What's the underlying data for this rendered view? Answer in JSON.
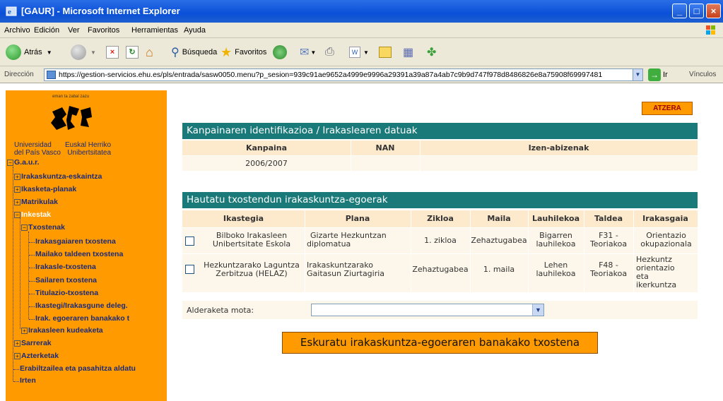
{
  "window": {
    "title": "[GAUR] - Microsoft Internet Explorer"
  },
  "menu": [
    "Archivo",
    "Edición",
    "Ver",
    "Favoritos",
    "Herramientas",
    "Ayuda"
  ],
  "toolbar": {
    "back": "Atrás",
    "search": "Búsqueda",
    "favorites": "Favoritos"
  },
  "address": {
    "label": "Dirección",
    "url": "https://gestion-servicios.ehu.es/pls/entrada/sasw0050.menu?p_sesion=939c91ae9652a4999e9996a29391a39a87a4ab7c9b9d747f978d8486826e8a75908f69997481",
    "go": "Ir",
    "links": "Vínculos"
  },
  "sidebar": {
    "logo_caption": "eman ta zabal zazu",
    "uni_left": [
      "Universidad",
      "del País Vasco"
    ],
    "uni_right": [
      "Euskal Herriko",
      "Unibertsitatea"
    ],
    "tree": {
      "root": "G.a.u.r.",
      "items": [
        "Irakaskuntza-eskaintza",
        "Ikasketa-planak",
        "Matrikulak",
        "Inkestak",
        "Txostenak",
        "Irakasgaiaren txostena",
        "Mailako taldeen txostena",
        "Irakasle-txostena",
        "Sailaren txostena",
        "Titulazio-txostena",
        "Ikastegi/Irakasgune deleg.",
        "Irak. egoeraren banakako t",
        "Irakasleen kudeaketa",
        "Sarrerak",
        "Azterketak",
        "Erabiltzailea eta pasahitza aldatu",
        "Irten"
      ]
    }
  },
  "main": {
    "back_button": "ATZERA",
    "section1": {
      "title": "Kanpainaren identifikazioa / Irakaslearen datuak",
      "headers": [
        "Kanpaina",
        "NAN",
        "Izen-abizenak"
      ],
      "values": [
        "2006/2007",
        "",
        ""
      ]
    },
    "section2": {
      "title": "Hautatu txostendun irakaskuntza-egoerak",
      "headers": [
        "Ikastegia",
        "Plana",
        "Zikloa",
        "Maila",
        "Lauhilekoa",
        "Taldea",
        "Irakasgaia"
      ],
      "rows": [
        {
          "ikastegia": [
            "Bilboko Irakasleen",
            "Unibertsitate Eskola"
          ],
          "plana": [
            "Gizarte Hezkuntzan",
            "diplomatua"
          ],
          "zikloa": "1. zikloa",
          "maila": "Zehaztugabea",
          "lauhilekoa": [
            "Bigarren",
            "lauhilekoa"
          ],
          "taldea": [
            "F31 -",
            "Teoriakoa"
          ],
          "irakasgaia": [
            "Orientazio",
            "okupazionala"
          ]
        },
        {
          "ikastegia": [
            "Hezkuntzarako Laguntza",
            "Zerbitzua (HELAZ)"
          ],
          "plana": [
            "Irakaskuntzarako",
            "Gaitasun Ziurtagiria"
          ],
          "zikloa": "Zehaztugabea",
          "maila": "1. maila",
          "lauhilekoa": [
            "Lehen",
            "lauhilekoa"
          ],
          "taldea": [
            "F48 -",
            "Teoriakoa"
          ],
          "irakasgaia": [
            "Hezkuntz",
            "orientazio",
            "eta",
            "ikerkuntza"
          ]
        }
      ]
    },
    "compare_label": "Alderaketa mota:",
    "compare_value": "",
    "submit": "Eskuratu irakaskuntza-egoeraren banakako txostena"
  }
}
